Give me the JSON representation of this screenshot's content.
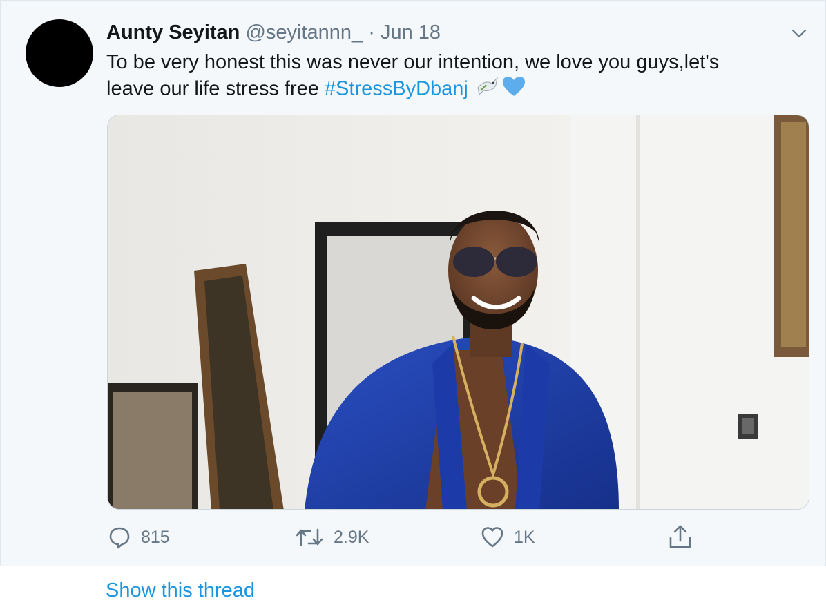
{
  "tweet": {
    "author_name": "Aunty Seyitan",
    "handle": "@seyitannn_",
    "separator": "·",
    "date": "Jun 18",
    "text_line1": "To be very honest this was never our intention, we love you guys,let's",
    "text_line2_prefix": "leave our life stress free ",
    "hashtag": "#StressByDbanj",
    "emojis": [
      "dove-emoji",
      "blue-heart-emoji"
    ],
    "media_description_icon": "photo"
  },
  "actions": {
    "reply_count": "815",
    "retweet_count": "2.9K",
    "like_count": "1K"
  },
  "thread": {
    "show_label": "Show this thread"
  },
  "colors": {
    "link": "#1b95e0",
    "muted": "#657786",
    "background": "#f5f8fa",
    "heart": "#5dadec"
  }
}
